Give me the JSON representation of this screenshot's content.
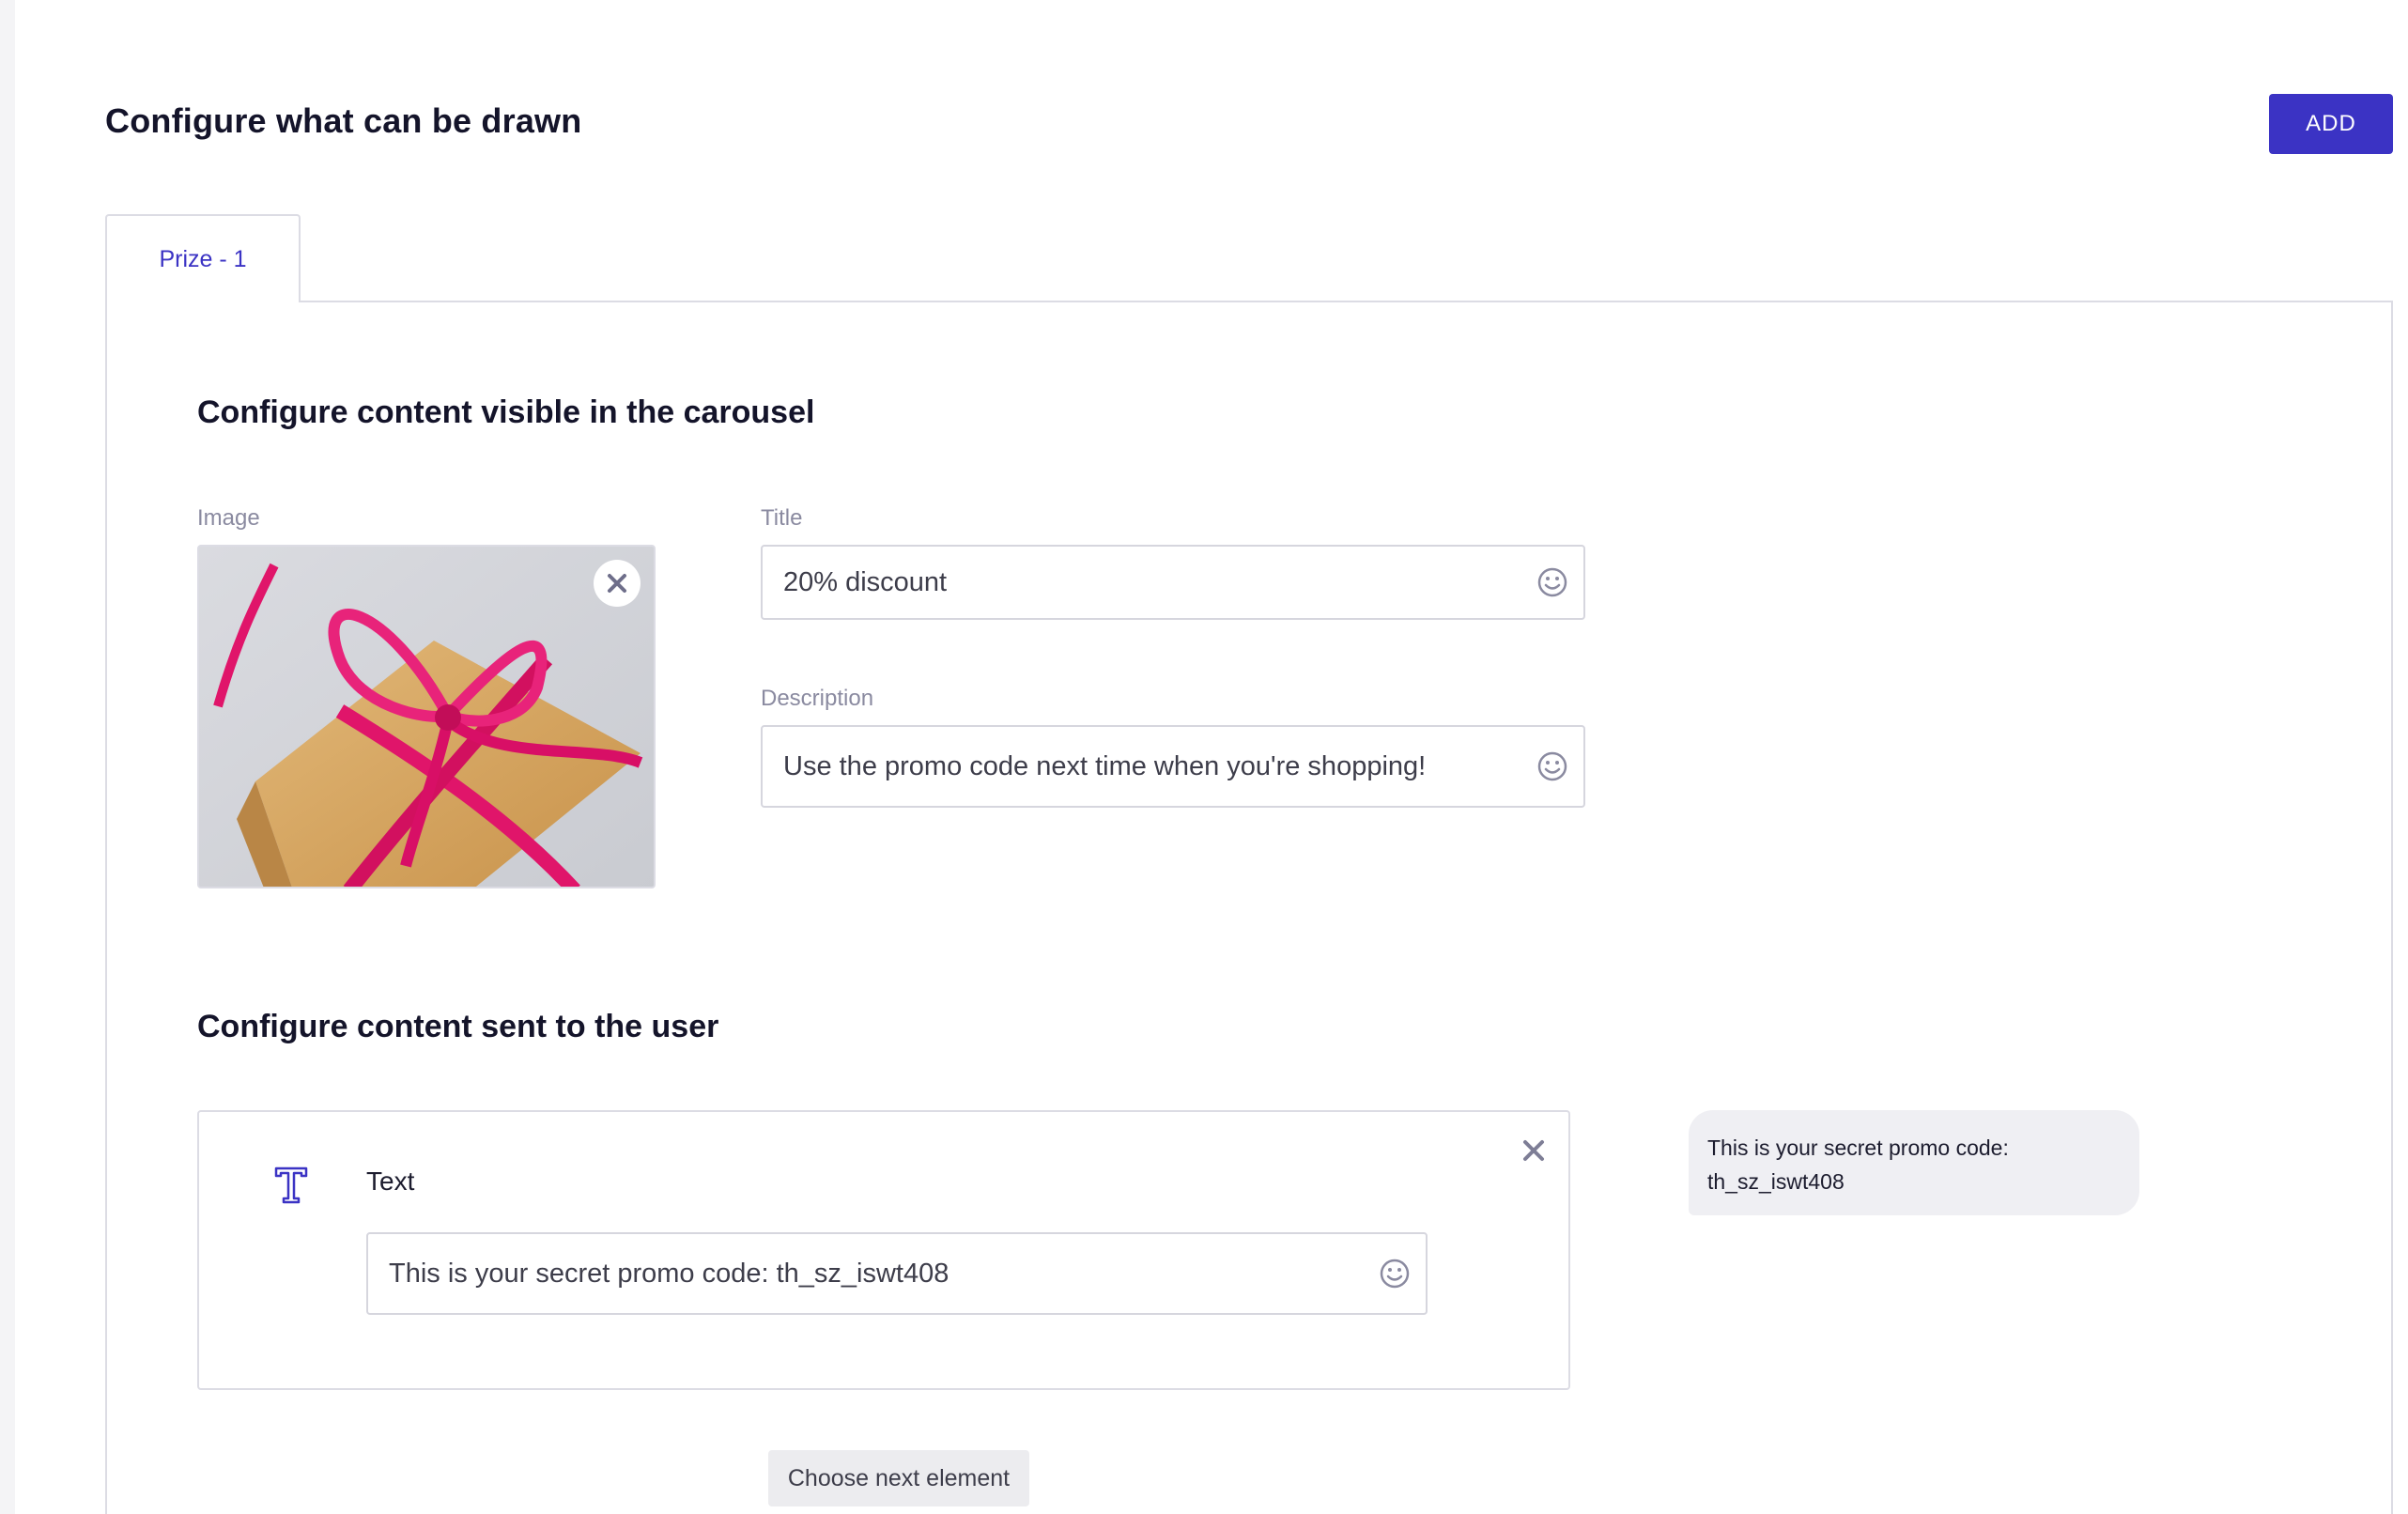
{
  "header": {
    "title": "Configure what can be drawn",
    "add_label": "ADD"
  },
  "tabs": [
    {
      "label": "Prize - 1",
      "active": true
    }
  ],
  "carousel": {
    "section_title": "Configure content visible in the carousel",
    "image_label": "Image",
    "title_label": "Title",
    "title_value": "20% discount",
    "description_label": "Description",
    "description_value": "Use the promo code next time when you're shopping!"
  },
  "user_content": {
    "section_title": "Configure content sent to the user",
    "element_type_label": "Text",
    "text_value": "This is your secret promo code: th_sz_iswt408",
    "preview_line1": "This is your secret promo code:",
    "preview_line2": "th_sz_iswt408",
    "next_element_label": "Choose next element"
  },
  "icons": {
    "emoji": "smiley-icon",
    "close": "close-icon",
    "text_type": "text-type-icon"
  },
  "colors": {
    "accent": "#3b33c4",
    "border": "#dcdce4",
    "muted_text": "#8a8aa0",
    "gift_ribbon": "#e0156a",
    "gift_paper": "#d9a760"
  }
}
